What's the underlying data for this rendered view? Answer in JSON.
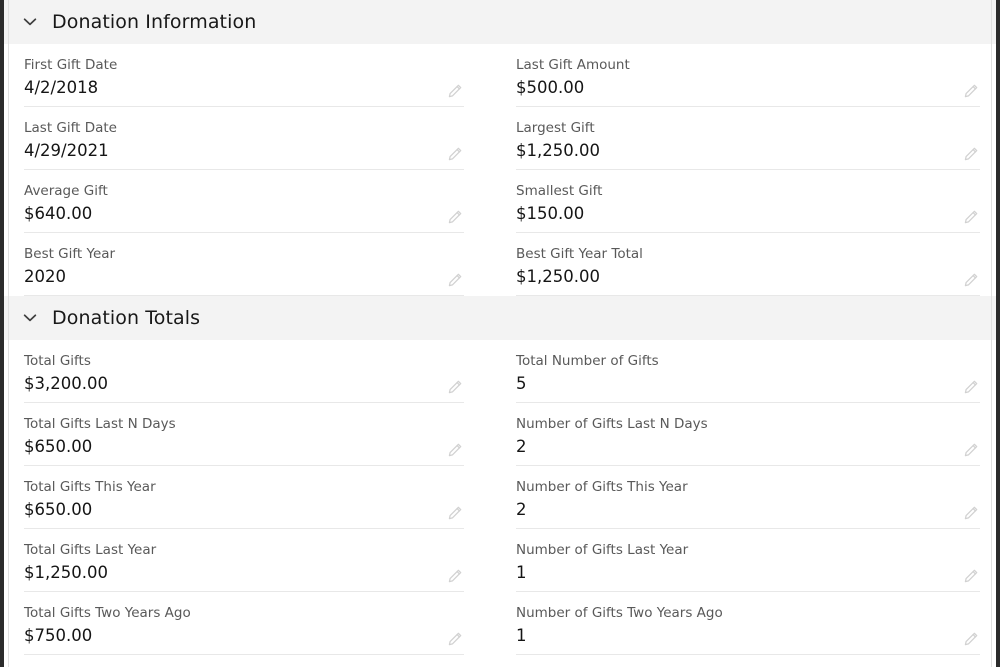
{
  "icons": {
    "collapse_chevron": "chevron-down-icon",
    "edit_pencil": "pencil-icon"
  },
  "colors": {
    "section_header_bg": "#f3f3f3",
    "label_text": "#595959",
    "value_text": "#151515",
    "divider": "#e8e8e8",
    "frame_rail": "#2b2b2b",
    "pencil": "#c9c9c9"
  },
  "sections": [
    {
      "id": "donation-information",
      "title": "Donation Information",
      "expanded": true,
      "fields": [
        {
          "label": "First Gift Date",
          "value": "4/2/2018",
          "column": "left"
        },
        {
          "label": "Last Gift Amount",
          "value": "$500.00",
          "column": "right"
        },
        {
          "label": "Last Gift Date",
          "value": "4/29/2021",
          "column": "left"
        },
        {
          "label": "Largest Gift",
          "value": "$1,250.00",
          "column": "right"
        },
        {
          "label": "Average Gift",
          "value": "$640.00",
          "column": "left"
        },
        {
          "label": "Smallest Gift",
          "value": "$150.00",
          "column": "right"
        },
        {
          "label": "Best Gift Year",
          "value": "2020",
          "column": "left"
        },
        {
          "label": "Best Gift Year Total",
          "value": "$1,250.00",
          "column": "right"
        }
      ]
    },
    {
      "id": "donation-totals",
      "title": "Donation Totals",
      "expanded": true,
      "fields": [
        {
          "label": "Total Gifts",
          "value": "$3,200.00",
          "column": "left"
        },
        {
          "label": "Total Number of Gifts",
          "value": "5",
          "column": "right"
        },
        {
          "label": "Total Gifts Last N Days",
          "value": "$650.00",
          "column": "left"
        },
        {
          "label": "Number of Gifts Last N Days",
          "value": "2",
          "column": "right"
        },
        {
          "label": "Total Gifts This Year",
          "value": "$650.00",
          "column": "left"
        },
        {
          "label": "Number of Gifts This Year",
          "value": "2",
          "column": "right"
        },
        {
          "label": "Total Gifts Last Year",
          "value": "$1,250.00",
          "column": "left"
        },
        {
          "label": "Number of Gifts Last Year",
          "value": "1",
          "column": "right"
        },
        {
          "label": "Total Gifts Two Years Ago",
          "value": "$750.00",
          "column": "left"
        },
        {
          "label": "Number of Gifts Two Years Ago",
          "value": "1",
          "column": "right"
        }
      ]
    }
  ]
}
